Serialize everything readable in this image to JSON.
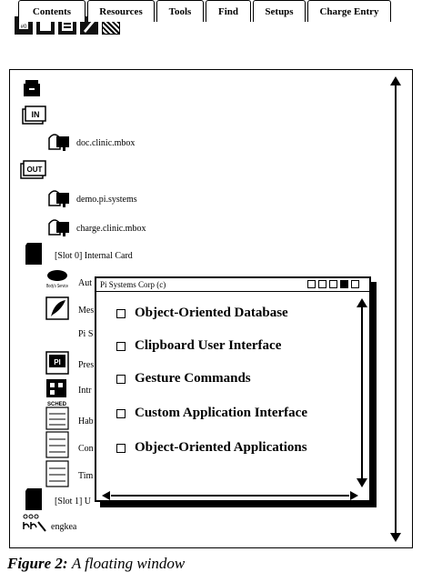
{
  "toolbar": {
    "icons": [
      "notebook-icon",
      "phone-icon",
      "address-card-icon",
      "pen-icon",
      "pattern-icon"
    ]
  },
  "tabs": [
    "Contents",
    "Resources",
    "Tools",
    "Find",
    "Setups",
    "Charge Entry"
  ],
  "tree": {
    "in_label": "IN",
    "out_label": "OUT",
    "items": [
      {
        "label": "doc.clinic.mbox"
      },
      {
        "label": "demo.pi.systems"
      },
      {
        "label": "charge.clinic.mbox"
      },
      {
        "label": "[Slot 0] Internal Card"
      },
      {
        "label": "Aut"
      },
      {
        "label": "Mes"
      },
      {
        "label": "Pi S"
      },
      {
        "label": "Pres"
      },
      {
        "label": "Intr"
      },
      {
        "label": "Hab"
      },
      {
        "label": "Con"
      },
      {
        "label": "Tim"
      },
      {
        "label": "[Slot 1] U"
      },
      {
        "label": "engkea"
      }
    ],
    "icon_texts": {
      "body_label": "Body's Service",
      "pi_label": "PI",
      "sched_label": "SCHED",
      "abc_label": "ABC"
    }
  },
  "floating_window": {
    "title": "Pi Systems Corp (c)",
    "items": [
      "Object-Oriented Database",
      "Clipboard User Interface",
      "Gesture Commands",
      "Custom Application Interface",
      "Object-Oriented Applications"
    ]
  },
  "caption": {
    "label": "Figure 2:",
    "text": "A floating window"
  }
}
